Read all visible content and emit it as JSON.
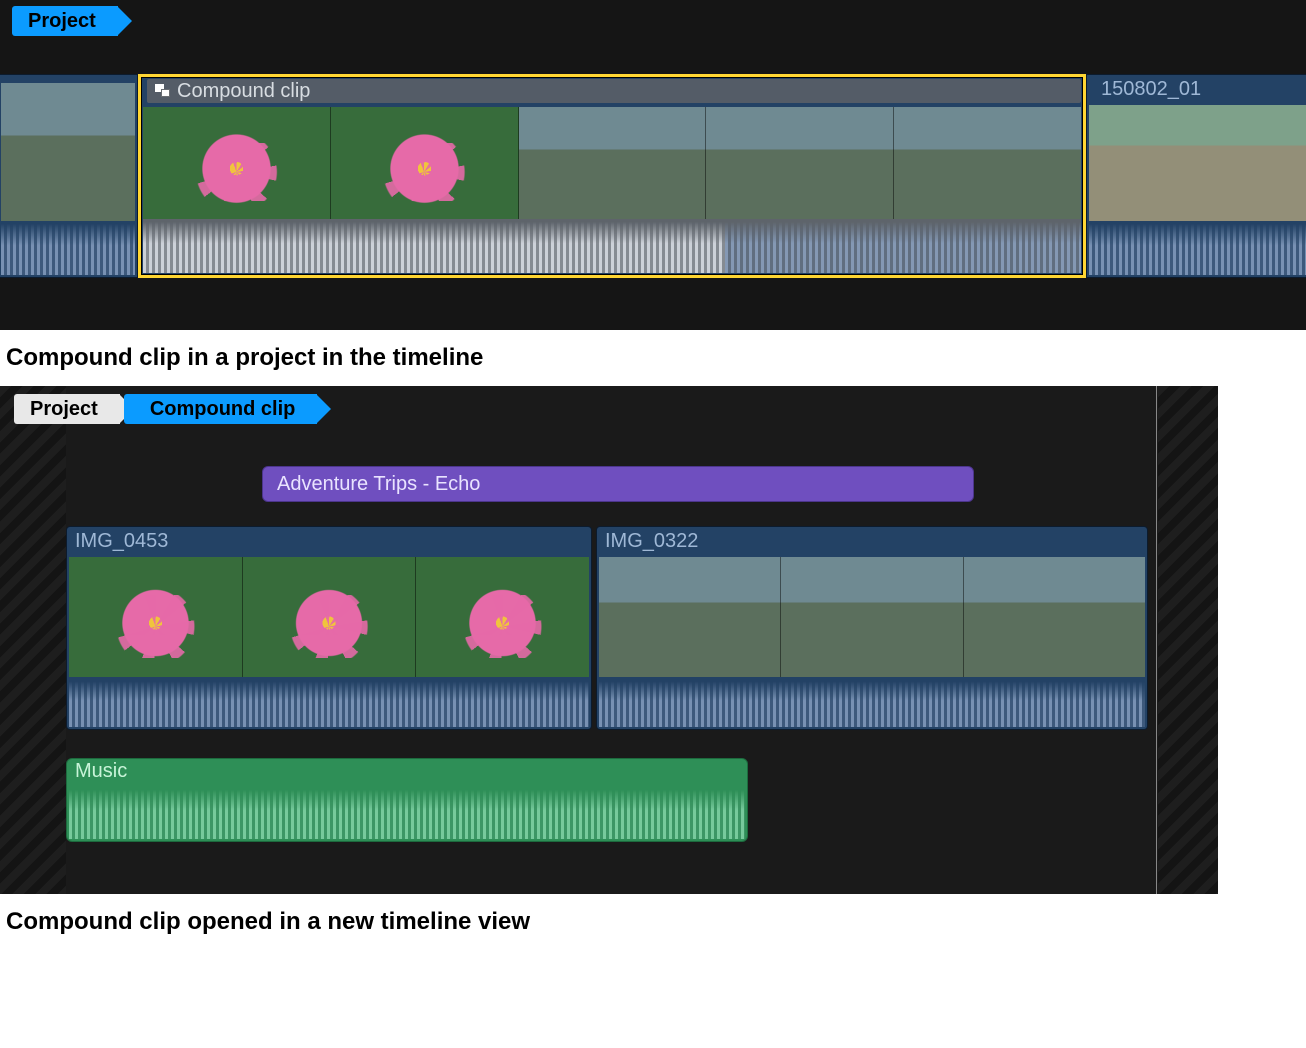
{
  "top": {
    "breadcrumbs": [
      "Project"
    ],
    "clips": {
      "left": {
        "name": ""
      },
      "compound": {
        "name": "Compound clip"
      },
      "right": {
        "name": "150802_01"
      }
    }
  },
  "caption1": "Compound clip in a project in the timeline",
  "inside": {
    "breadcrumbs": [
      "Project",
      "Compound clip"
    ],
    "title_clip": {
      "name": "Adventure Trips - Echo"
    },
    "video": [
      {
        "name": "IMG_0453"
      },
      {
        "name": "IMG_0322"
      }
    ],
    "audio": {
      "name": "Music"
    }
  },
  "caption2": "Compound clip opened in a new timeline view",
  "colors": {
    "accent": "#0b9bff",
    "select": "#ffd633",
    "title_track": "#6f4fbf",
    "audio_track": "#2e8f57",
    "video_track": "#234265"
  }
}
